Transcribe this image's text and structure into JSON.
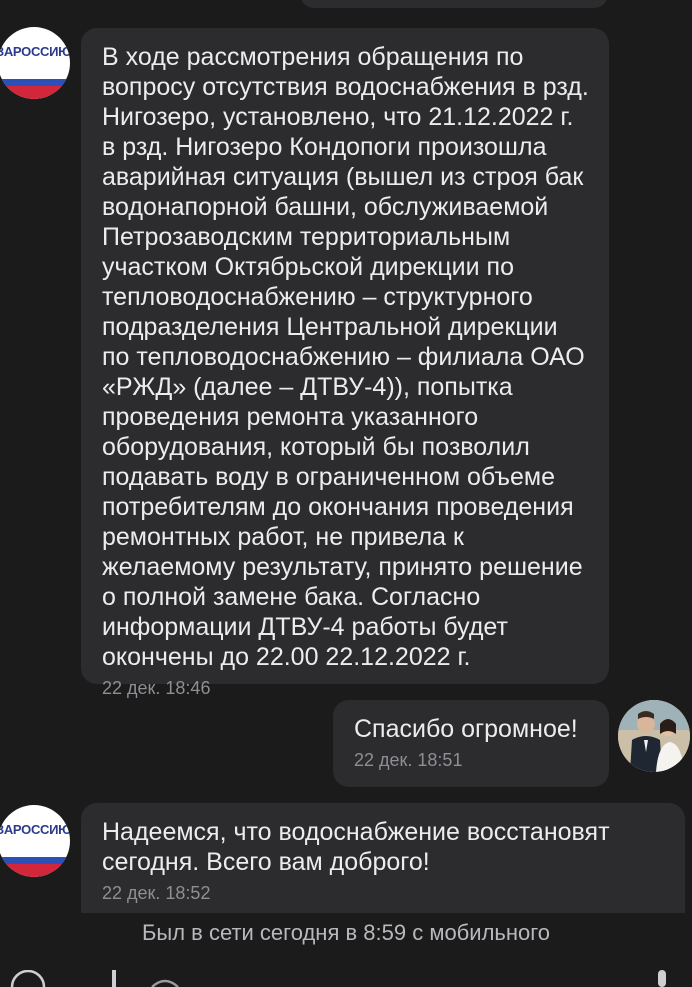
{
  "messages": [
    {
      "sender": "incoming",
      "avatar_text": "ЗАРОССИЮ",
      "text": "В ходе рассмотрения обращения по вопросу отсутствия водоснабжения в рзд. Нигозеро, установлено, что 21.12.2022 г. в рзд. Нигозеро Кондопоги произошла аварийная ситуация (вышел из строя бак водонапорной башни, обслуживаемой Петрозаводским территориальным участком Октябрьской дирекции по тепловодоснабжению – структурного подразделения Центральной дирекции по тепловодоснабжению – филиала ОАО «РЖД» (далее – ДТВУ-4)), попытка проведения ремонта указанного оборудования, который бы позволил подавать воду в ограниченном объеме потребителям до окончания проведения ремонтных работ, не привела к желаемому результату, принято решение о полной замене бака. Согласно информации ДТВУ-4 работы будет окончены до 22.00 22.12.2022 г.",
      "time": "22 дек. 18:46"
    },
    {
      "sender": "outgoing",
      "text": "Спасибо огромное!",
      "time": "22 дек. 18:51"
    },
    {
      "sender": "incoming",
      "avatar_text": "ЗАРОССИЮ",
      "text": "Надеемся, что водоснабжение восстановят сегодня. Всего вам доброго!",
      "time": "22 дек. 18:52"
    }
  ],
  "status_text": "Был в сети сегодня в 8:59 с мобильного",
  "colors": {
    "background": "#1b1b1c",
    "bubble": "#2c2c2f",
    "timestamp": "#8e8e93"
  }
}
